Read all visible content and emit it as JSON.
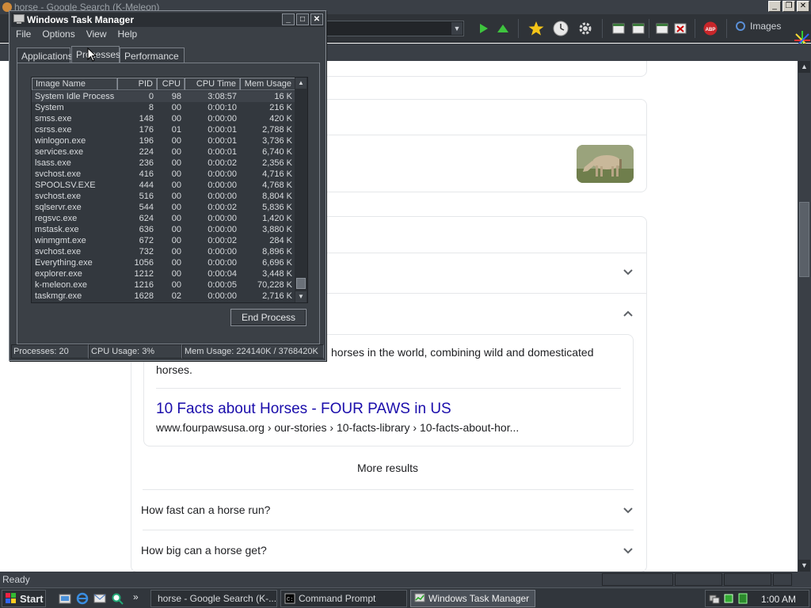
{
  "browser": {
    "title": "horse - Google Search (K-Meleon)",
    "images_button": "Images",
    "status_text": "Ready"
  },
  "page": {
    "snippet_line1": "horses in the world, combining wild and domesticated",
    "snippet_line2": "horses.",
    "result_title": "10 Facts about Horses - FOUR PAWS in US",
    "result_url": "www.fourpawsusa.org › our-stories › 10-facts-library › 10-facts-about-hor...",
    "more_results": "More results",
    "questions": [
      "How fast can a horse run?",
      "How big can a horse get?"
    ]
  },
  "taskmgr": {
    "title": "Windows Task Manager",
    "menu": [
      "File",
      "Options",
      "View",
      "Help"
    ],
    "tabs": [
      "Applications",
      "Processes",
      "Performance"
    ],
    "columns": [
      "Image Name",
      "PID",
      "CPU",
      "CPU Time",
      "Mem Usage"
    ],
    "processes": [
      {
        "name": "System Idle Process",
        "pid": "0",
        "cpu": "98",
        "time": "3:08:57",
        "mem": "16 K"
      },
      {
        "name": "System",
        "pid": "8",
        "cpu": "00",
        "time": "0:00:10",
        "mem": "216 K"
      },
      {
        "name": "smss.exe",
        "pid": "148",
        "cpu": "00",
        "time": "0:00:00",
        "mem": "420 K"
      },
      {
        "name": "csrss.exe",
        "pid": "176",
        "cpu": "01",
        "time": "0:00:01",
        "mem": "2,788 K"
      },
      {
        "name": "winlogon.exe",
        "pid": "196",
        "cpu": "00",
        "time": "0:00:01",
        "mem": "3,736 K"
      },
      {
        "name": "services.exe",
        "pid": "224",
        "cpu": "00",
        "time": "0:00:01",
        "mem": "6,740 K"
      },
      {
        "name": "lsass.exe",
        "pid": "236",
        "cpu": "00",
        "time": "0:00:02",
        "mem": "2,356 K"
      },
      {
        "name": "svchost.exe",
        "pid": "416",
        "cpu": "00",
        "time": "0:00:00",
        "mem": "4,716 K"
      },
      {
        "name": "SPOOLSV.EXE",
        "pid": "444",
        "cpu": "00",
        "time": "0:00:00",
        "mem": "4,768 K"
      },
      {
        "name": "svchost.exe",
        "pid": "516",
        "cpu": "00",
        "time": "0:00:00",
        "mem": "8,804 K"
      },
      {
        "name": "sqlservr.exe",
        "pid": "544",
        "cpu": "00",
        "time": "0:00:02",
        "mem": "5,836 K"
      },
      {
        "name": "regsvc.exe",
        "pid": "624",
        "cpu": "00",
        "time": "0:00:00",
        "mem": "1,420 K"
      },
      {
        "name": "mstask.exe",
        "pid": "636",
        "cpu": "00",
        "time": "0:00:00",
        "mem": "3,880 K"
      },
      {
        "name": "winmgmt.exe",
        "pid": "672",
        "cpu": "00",
        "time": "0:00:02",
        "mem": "284 K"
      },
      {
        "name": "svchost.exe",
        "pid": "732",
        "cpu": "00",
        "time": "0:00:00",
        "mem": "8,896 K"
      },
      {
        "name": "Everything.exe",
        "pid": "1056",
        "cpu": "00",
        "time": "0:00:00",
        "mem": "6,696 K"
      },
      {
        "name": "explorer.exe",
        "pid": "1212",
        "cpu": "00",
        "time": "0:00:04",
        "mem": "3,448 K"
      },
      {
        "name": "k-meleon.exe",
        "pid": "1216",
        "cpu": "00",
        "time": "0:00:05",
        "mem": "70,228 K"
      },
      {
        "name": "taskmgr.exe",
        "pid": "1628",
        "cpu": "02",
        "time": "0:00:00",
        "mem": "2,716 K"
      }
    ],
    "end_process": "End Process",
    "status": {
      "processes": "Processes: 20",
      "cpu": "CPU Usage: 3%",
      "mem": "Mem Usage: 224140K / 3768420K"
    }
  },
  "taskbar": {
    "start": "Start",
    "tasks": [
      {
        "label": "horse - Google Search (K-...",
        "icon": "browser-icon"
      },
      {
        "label": "Command Prompt",
        "icon": "console-icon"
      },
      {
        "label": "Windows Task Manager",
        "icon": "taskmgr-icon"
      }
    ],
    "clock": "1:00 AM",
    "quick_launch_more": "»"
  }
}
